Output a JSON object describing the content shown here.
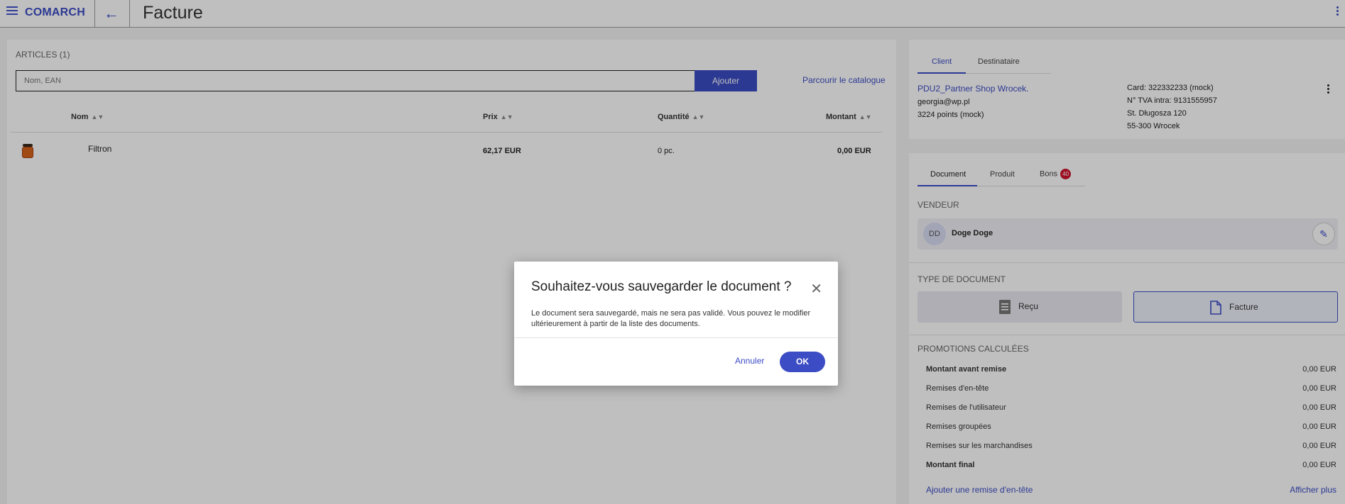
{
  "header": {
    "logo": "COMARCH",
    "title": "Facture"
  },
  "articles": {
    "title": "ARTICLES (1)",
    "search_placeholder": "Nom, EAN",
    "add_label": "Ajouter",
    "catalog_link": "Parcourir le catalogue",
    "columns": {
      "name": "Nom",
      "price": "Prix",
      "quantity": "Quantité",
      "amount": "Montant"
    },
    "rows": [
      {
        "name": "Filtron",
        "price": "62,17 EUR",
        "quantity": "0 pc.",
        "amount": "0,00 EUR"
      }
    ]
  },
  "client": {
    "tabs": [
      "Client",
      "Destinataire"
    ],
    "name": "PDU2_Partner Shop Wrocek.",
    "email": "georgia@wp.pl",
    "points": "3224 points (mock)",
    "card": "Card: 322332233 (mock)",
    "vat": "N° TVA intra: 9131555957",
    "street": "St. Długosza 120",
    "city": "55-300 Wrocek"
  },
  "document": {
    "tabs": [
      "Document",
      "Produit",
      "Bons"
    ],
    "bons_badge": "40",
    "seller_section": "VENDEUR",
    "seller_initials": "DD",
    "seller_name": "Doge Doge",
    "type_section": "TYPE DE DOCUMENT",
    "type_recu": "Reçu",
    "type_facture": "Facture",
    "promo_section": "PROMOTIONS CALCULÉES",
    "promos": [
      {
        "label": "Montant avant remise",
        "value": "0,00 EUR"
      },
      {
        "label": "Remises d'en-tête",
        "value": "0,00 EUR"
      },
      {
        "label": "Remises de l'utilisateur",
        "value": "0,00 EUR"
      },
      {
        "label": "Remises groupées",
        "value": "0,00 EUR"
      },
      {
        "label": "Remises sur les marchandises",
        "value": "0,00 EUR"
      },
      {
        "label": "Montant final",
        "value": "0,00 EUR"
      }
    ],
    "add_header_discount": "Ajouter une remise d'en-tête",
    "show_more": "Afficher plus"
  },
  "dialog": {
    "title": "Souhaitez-vous sauvegarder le document ?",
    "text": "Le document sera sauvegardé, mais ne sera pas validé. Vous pouvez le modifier ultérieurement à partir de la liste des documents.",
    "cancel": "Annuler",
    "ok": "OK"
  },
  "colors": {
    "accent": "#3b4cc4",
    "badge": "#d0142c"
  }
}
